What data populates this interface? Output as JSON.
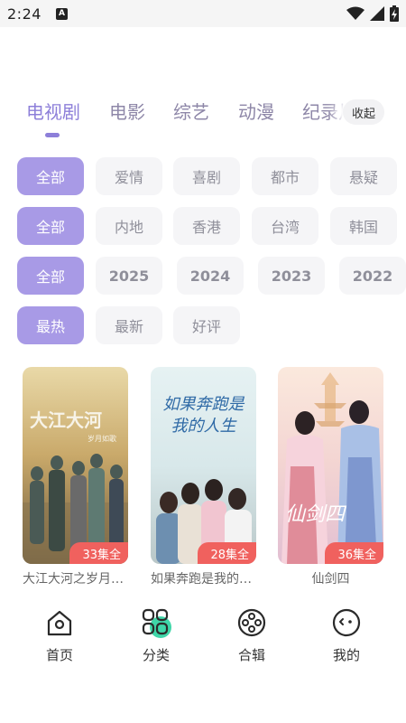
{
  "status_bar": {
    "time": "2:24",
    "notification_letter": "A"
  },
  "tabs": [
    {
      "label": "电视剧",
      "active": true
    },
    {
      "label": "电影",
      "active": false
    },
    {
      "label": "综艺",
      "active": false
    },
    {
      "label": "动漫",
      "active": false
    },
    {
      "label": "纪录片",
      "active": false
    }
  ],
  "collapse_label": "收起",
  "filters": {
    "genre": [
      "全部",
      "爱情",
      "喜剧",
      "都市",
      "悬疑"
    ],
    "region": [
      "全部",
      "内地",
      "香港",
      "台湾",
      "韩国"
    ],
    "year": [
      "全部",
      "2025",
      "2024",
      "2023",
      "2022"
    ],
    "sort": [
      "最热",
      "最新",
      "好评"
    ]
  },
  "cards": [
    {
      "title": "大江大河之岁月如歌",
      "episodes": "33集全",
      "poster_text": "大江大河",
      "poster_subtitle": "岁月如歌"
    },
    {
      "title": "如果奔跑是我的人生",
      "episodes": "28集全",
      "poster_text": "如果奔跑是我的人生"
    },
    {
      "title": "仙剑四",
      "episodes": "36集全",
      "poster_text": "仙剑四"
    }
  ],
  "bottom_nav": [
    {
      "label": "首页",
      "icon": "home-icon"
    },
    {
      "label": "分类",
      "icon": "category-icon"
    },
    {
      "label": "合辑",
      "icon": "film-reel-icon"
    },
    {
      "label": "我的",
      "icon": "profile-face-icon"
    }
  ],
  "colors": {
    "accent": "#8d7fd9",
    "chip_selected": "#a89ae6",
    "badge": "#f0615e",
    "nav_highlight": "#3fd6a8"
  }
}
